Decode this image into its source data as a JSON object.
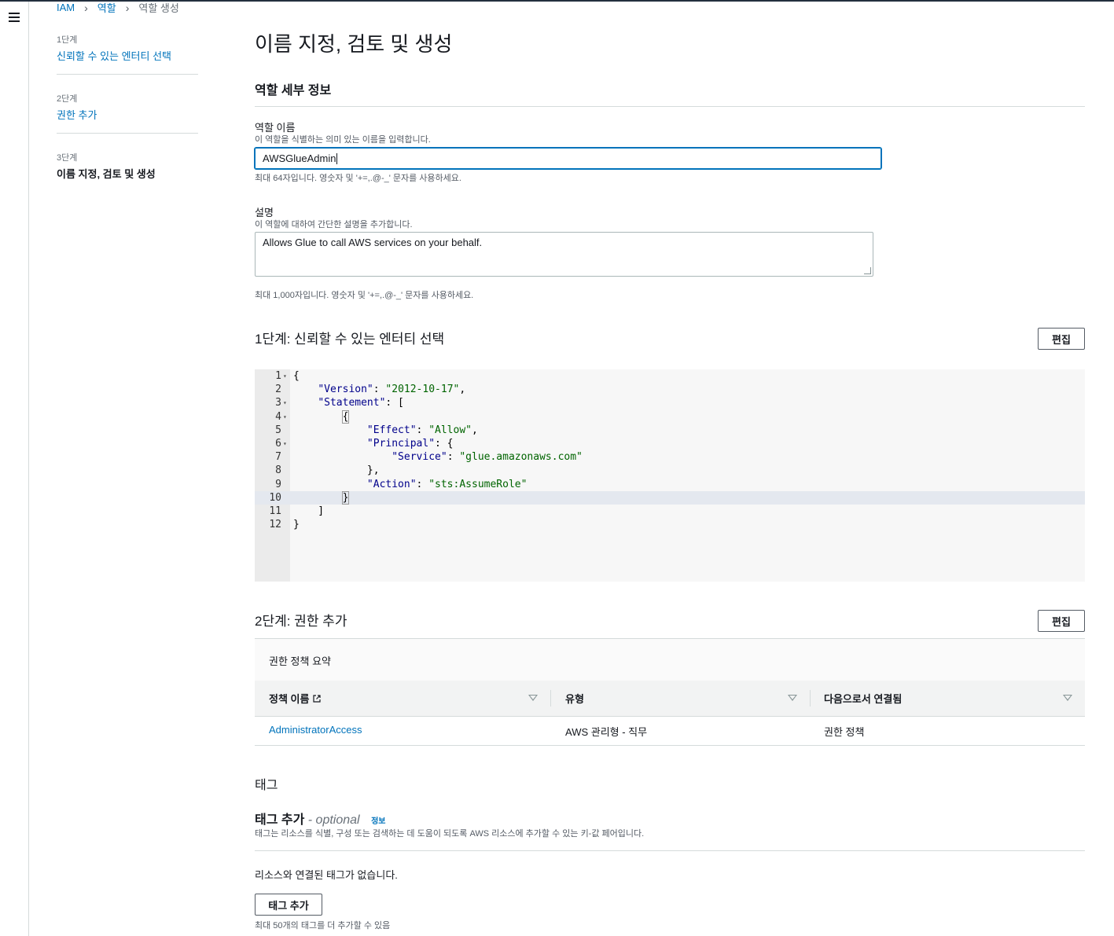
{
  "breadcrumb": {
    "items": [
      "IAM",
      "역할",
      "역할 생성"
    ]
  },
  "steps": [
    {
      "number": "1단계",
      "label": "신뢰할 수 있는 엔터티 선택"
    },
    {
      "number": "2단계",
      "label": "권한 추가"
    },
    {
      "number": "3단계",
      "label": "이름 지정, 검토 및 생성"
    }
  ],
  "page_title": "이름 지정, 검토 및 생성",
  "role_details": {
    "title": "역할 세부 정보",
    "name_label": "역할 이름",
    "name_desc": "이 역할을 식별하는 의미 있는 이름을 입력합니다.",
    "name_value": "AWSGlueAdmin",
    "name_constraint": "최대 64자입니다. 영숫자 및 '+=,.@-_' 문자를 사용하세요.",
    "desc_label": "설명",
    "desc_desc": "이 역할에 대하여 간단한 설명을 추가합니다.",
    "desc_value": "Allows Glue to call AWS services on your behalf.",
    "desc_constraint": "최대 1,000자입니다. 영숫자 및 '+=,.@-_' 문자를 사용하세요."
  },
  "step1": {
    "title": "1단계: 신뢰할 수 있는 엔터티 선택",
    "edit_label": "편집",
    "code_lines": [
      {
        "n": "1",
        "text": "{"
      },
      {
        "n": "2",
        "text": "    \"Version\": \"2012-10-17\","
      },
      {
        "n": "3",
        "text": "    \"Statement\": ["
      },
      {
        "n": "4",
        "text": "        {"
      },
      {
        "n": "5",
        "text": "            \"Effect\": \"Allow\","
      },
      {
        "n": "6",
        "text": "            \"Principal\": {"
      },
      {
        "n": "7",
        "text": "                \"Service\": \"glue.amazonaws.com\""
      },
      {
        "n": "8",
        "text": "            },"
      },
      {
        "n": "9",
        "text": "            \"Action\": \"sts:AssumeRole\""
      },
      {
        "n": "10",
        "text": "        }"
      },
      {
        "n": "11",
        "text": "    ]"
      },
      {
        "n": "12",
        "text": "}"
      }
    ]
  },
  "step2": {
    "title": "2단계: 권한 추가",
    "edit_label": "편집",
    "panel_title": "권한 정책 요약",
    "columns": [
      "정책 이름",
      "유형",
      "다음으로서 연결됨"
    ],
    "rows": [
      {
        "name": "AdministratorAccess",
        "type": "AWS 관리형 - 직무",
        "attached": "권한 정책"
      }
    ]
  },
  "tags": {
    "title": "태그",
    "add_title": "태그 추가",
    "optional": "- optional",
    "info": "정보",
    "desc": "태그는 리소스를 식별, 구성 또는 검색하는 데 도움이 되도록 AWS 리소스에 추가할 수 있는 키-값 페어입니다.",
    "empty": "리소스와 연결된 태그가 없습니다.",
    "add_button": "태그 추가",
    "limit": "최대 50개의 태그를 더 추가할 수 있음"
  }
}
